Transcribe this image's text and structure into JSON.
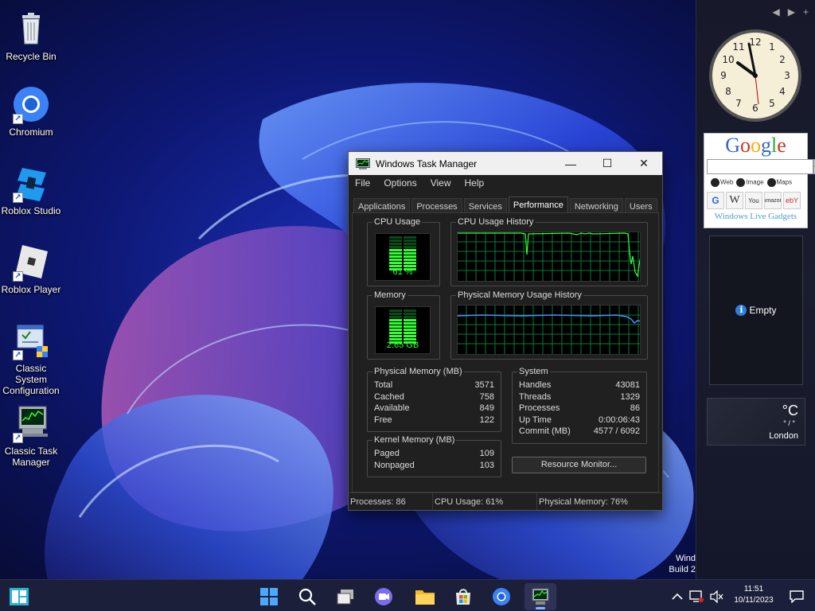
{
  "desktop": {
    "icons": [
      {
        "label": "Recycle Bin",
        "icon": "recycle-bin-icon"
      },
      {
        "label": "Chromium",
        "icon": "chromium-icon"
      },
      {
        "label": "Roblox Studio",
        "icon": "roblox-studio-icon"
      },
      {
        "label": "Roblox Player",
        "icon": "roblox-player-icon"
      },
      {
        "label": "Classic System Configuration",
        "icon": "system-configuration-icon"
      },
      {
        "label": "Classic Task Manager",
        "icon": "task-manager-icon"
      }
    ]
  },
  "taskmanager": {
    "title": "Windows Task Manager",
    "menu": [
      "File",
      "Options",
      "View",
      "Help"
    ],
    "tabs": [
      "Applications",
      "Processes",
      "Services",
      "Performance",
      "Networking",
      "Users"
    ],
    "active_tab": "Performance",
    "cpu_usage_label": "CPU Usage",
    "cpu_value": "61 %",
    "cpu_fraction": 0.61,
    "cpu_history_label": "CPU Usage History",
    "memory_label": "Memory",
    "memory_value": "2.65 GB",
    "memory_fraction": 0.76,
    "memory_history_label": "Physical Memory Usage History",
    "physical_memory": {
      "title": "Physical Memory (MB)",
      "rows": [
        {
          "label": "Total",
          "value": "3571"
        },
        {
          "label": "Cached",
          "value": "758"
        },
        {
          "label": "Available",
          "value": "849"
        },
        {
          "label": "Free",
          "value": "122"
        }
      ]
    },
    "kernel_memory": {
      "title": "Kernel Memory (MB)",
      "rows": [
        {
          "label": "Paged",
          "value": "109"
        },
        {
          "label": "Nonpaged",
          "value": "103"
        }
      ]
    },
    "system": {
      "title": "System",
      "rows": [
        {
          "label": "Handles",
          "value": "43081"
        },
        {
          "label": "Threads",
          "value": "1329"
        },
        {
          "label": "Processes",
          "value": "86"
        },
        {
          "label": "Up Time",
          "value": "0:00:06:43"
        },
        {
          "label": "Commit (MB)",
          "value": "4577 / 6092"
        }
      ]
    },
    "resource_monitor_label": "Resource Monitor...",
    "status": {
      "processes": "Processes: 86",
      "cpu": "CPU Usage: 61%",
      "memory": "Physical Memory: 76%"
    }
  },
  "sidebar": {
    "google": {
      "logo": "Google",
      "radio_web": "Web",
      "radio_image": "Image",
      "radio_maps": "Maps",
      "footer": "Windows Live Gadgets",
      "links": [
        "G",
        "W",
        "You",
        "amazon",
        "ebY"
      ]
    },
    "empty_gadget": "Empty",
    "weather": {
      "temp": "°C",
      "condition": "° / °",
      "city": "London"
    }
  },
  "watermark": {
    "line1": "Wind",
    "line2": "Build 2"
  },
  "tray": {
    "time": "11:51",
    "date": "10/11/2023"
  },
  "colors": {
    "taskbar": "#1c1f3a",
    "graph_green": "#33ff33",
    "graph_grid": "#0a7a3a"
  }
}
